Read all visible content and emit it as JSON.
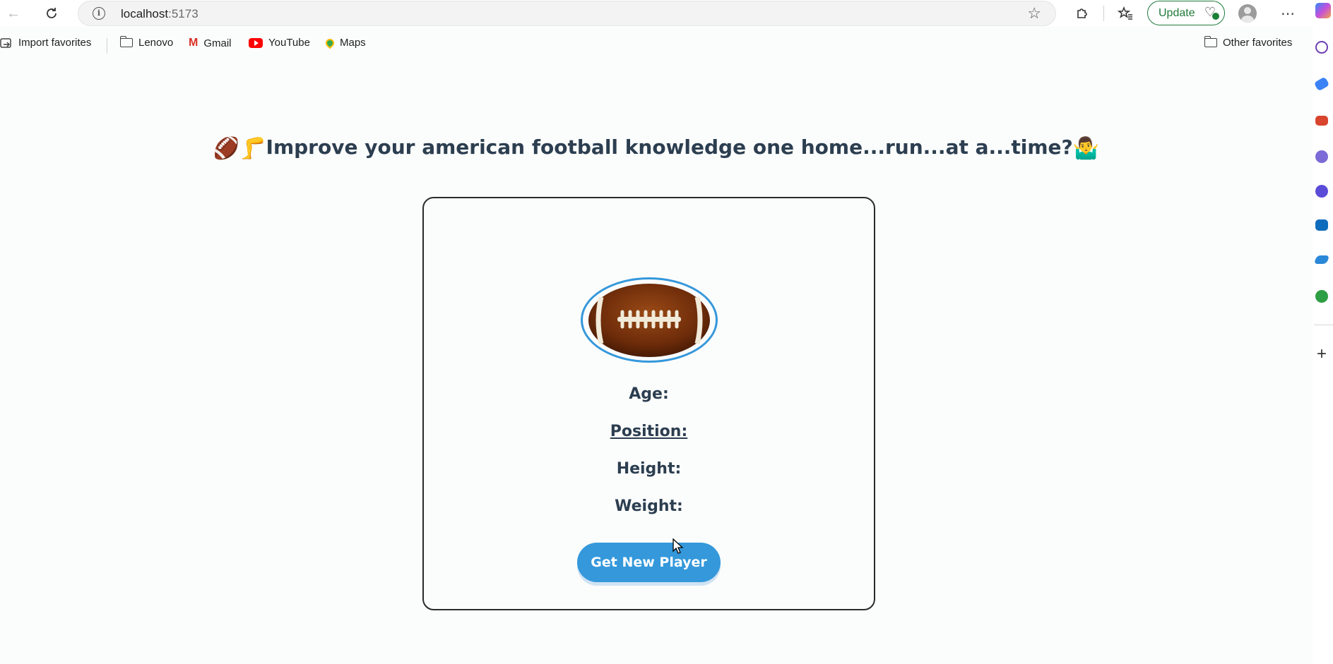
{
  "browser": {
    "address": {
      "host": "localhost",
      "port": ":5173"
    },
    "update_label": "Update",
    "favorites": [
      {
        "label": "Import favorites",
        "icon": "import-icon"
      },
      {
        "label": "Lenovo",
        "icon": "folder-icon"
      },
      {
        "label": "Gmail",
        "icon": "gmail-icon"
      },
      {
        "label": "YouTube",
        "icon": "youtube-icon"
      },
      {
        "label": "Maps",
        "icon": "maps-icon"
      }
    ],
    "other_favorites": "Other favorites"
  },
  "page": {
    "headline_prefix_emoji": "🏈🦵",
    "headline_text": "Improve your american football knowledge one home...run...at a...time?",
    "headline_suffix_emoji": "🤷‍♂️",
    "player": {
      "image": "football-image",
      "age_label": "Age:",
      "position_label": "Position:",
      "height_label": "Height:",
      "weight_label": "Weight:"
    },
    "get_player_button": "Get New Player"
  },
  "colors": {
    "accent": "#3498db",
    "heading_text": "#2c3e50",
    "update_green": "#1f7a3a"
  }
}
